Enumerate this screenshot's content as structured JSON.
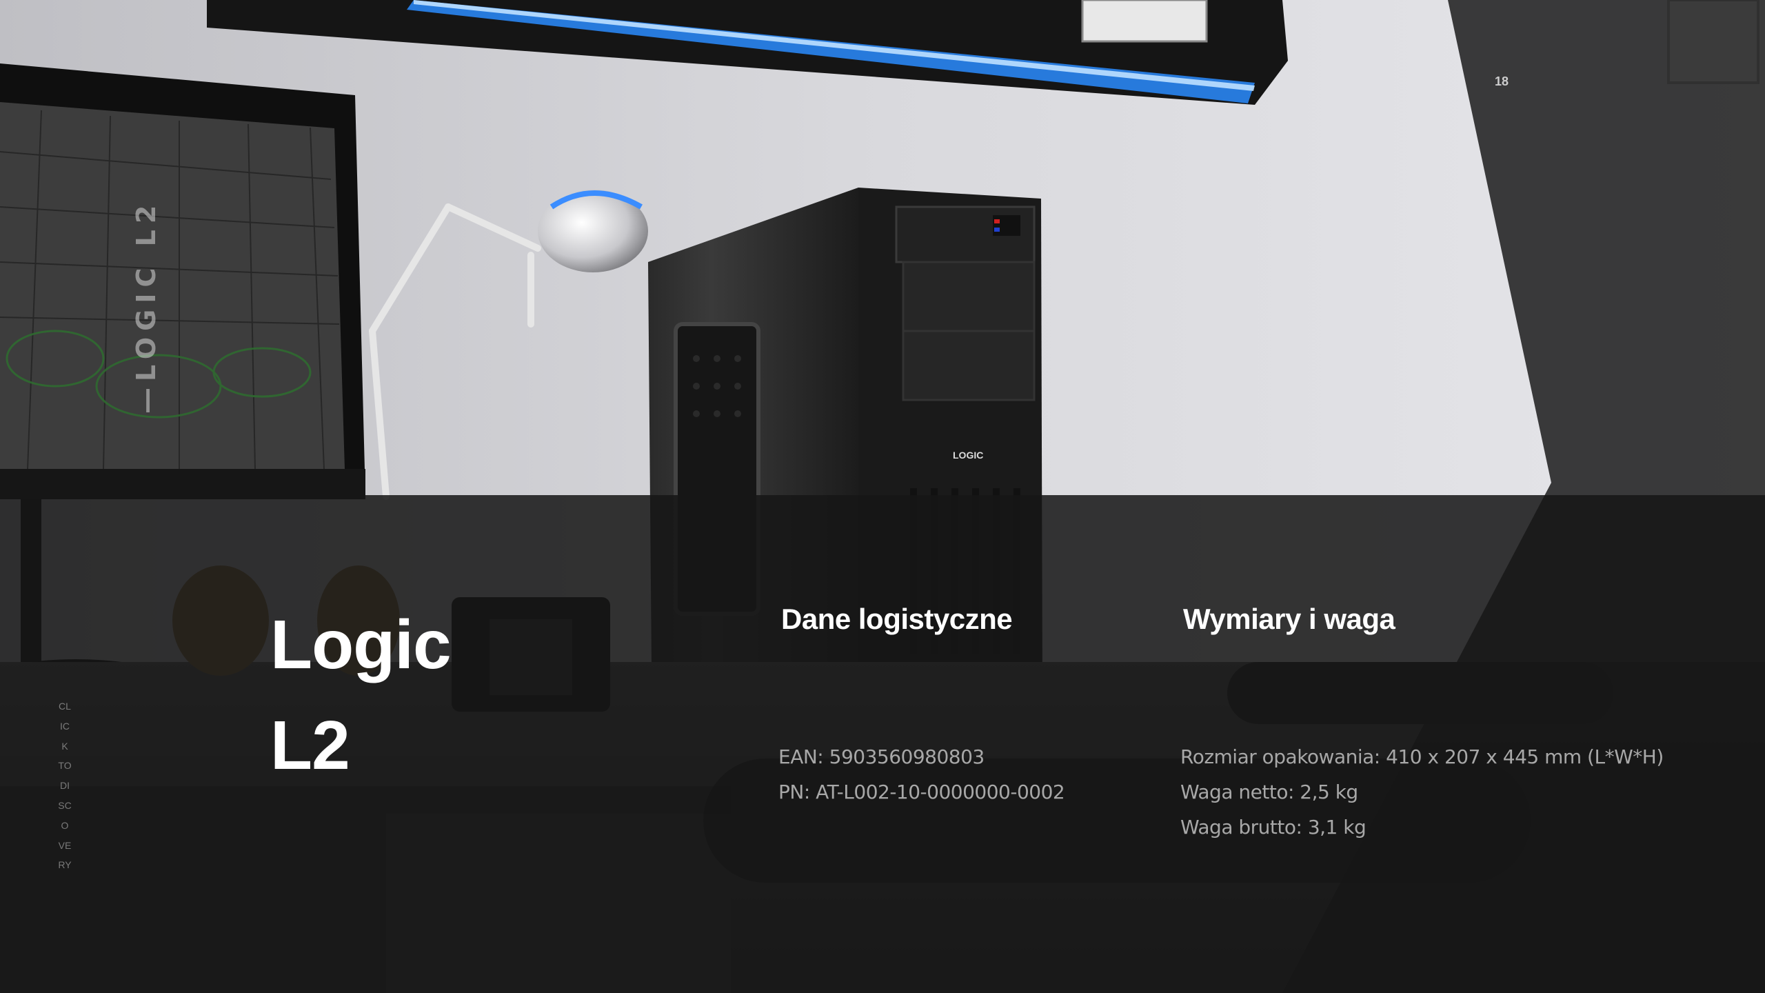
{
  "slide": {
    "page_number": "18",
    "vertical_product_label": "—LOGIC L2",
    "vertical_click_label": "CLICK TO DISCOVERY"
  },
  "product": {
    "title": "Logic L2"
  },
  "logistics": {
    "heading": "Dane logistyczne",
    "lines": [
      "EAN: 5903560980803",
      "PN: AT-L002-10-0000000-0002"
    ]
  },
  "dimensions": {
    "heading": "Wymiary i waga",
    "lines": [
      "Rozmiar opakowania: 410 x 207 x 445 mm (L*W*H)",
      "Waga netto: 2,5 kg",
      "Waga brutto: 3,1 kg"
    ]
  },
  "background": {
    "case_logo": "LOGIC",
    "colors": {
      "wall": "#d6d6da",
      "band": "#161616",
      "accent_led": "#2a8cff",
      "case": "#1e1e1e"
    }
  }
}
